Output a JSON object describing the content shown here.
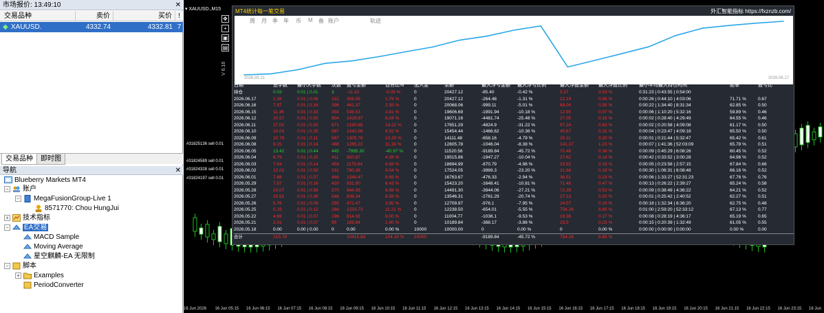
{
  "market_watch": {
    "title": "市场报价: 13:49:10",
    "columns": {
      "symbol": "交易品种",
      "bid": "卖价",
      "ask": "买价",
      "spread": "!"
    },
    "rows": [
      {
        "symbol": "XAUUSD.",
        "bid": "4332.74",
        "ask": "4332.81",
        "spread": "7"
      }
    ],
    "tabs": [
      "交易品种",
      "即时图"
    ]
  },
  "navigator": {
    "title": "导航",
    "root": "Blueberry Markets MT4",
    "accounts_label": "账户",
    "server": "MegaFusionGroup-Live 1",
    "account": "8571770: Chou HungJui",
    "indicators_label": "技术指标",
    "experts_label": "EA交易",
    "experts": [
      "MACD Sample",
      "Moving Average",
      "星空麒麟-EA 无限制"
    ],
    "scripts_label": "脚本",
    "scripts": [
      "Examples",
      "PeriodConverter"
    ]
  },
  "chart": {
    "title": "XAUUSD.,M15",
    "side_label": "V 6.16",
    "toolbar_icons": [
      "move-icon",
      "plus-icon",
      "floppy-icon",
      "screenshot-icon"
    ],
    "orders": [
      "#31825136 sell 0.01",
      "#31824589 sell 0.01",
      "#31824328 sell 0.01",
      "#31824197 sell 0.01"
    ],
    "time_axis": [
      "16 Jun 2026",
      "16 Jun 05:15",
      "16 Jun 06:15",
      "16 Jun 07:15",
      "16 Jun 08:15",
      "16 Jun 09:15",
      "16 Jun 10:15",
      "16 Jun 11:15",
      "16 Jun 12:15",
      "16 Jun 13:15",
      "16 Jun 14:15",
      "16 Jun 15:15",
      "16 Jun 16:15",
      "16 Jun 17:15",
      "16 Jun 18:15",
      "16 Jun 19:15",
      "16 Jun 20:15",
      "16 Jun 21:15",
      "16 Jun 22:15",
      "16 Jun 23:15",
      "16 Jun"
    ]
  },
  "panel": {
    "title": "MT4统计每一笔交易",
    "site": "外汇智能指标 https://fxznzb.com/",
    "period_tabs": [
      "日",
      "周",
      "月",
      "季",
      "年",
      "币",
      "M",
      "备",
      "账户",
      "轨迹"
    ],
    "selected_period": "日",
    "equity_start": "2026.05.21",
    "equity_end": "2026.06.17"
  },
  "table": {
    "headers": [
      "日期",
      "总手数",
      "最小大手数",
      "次数",
      "盈亏金额",
      "百分比%",
      "出入金",
      "余额",
      "最大浮亏金额",
      "最大浮亏比例",
      "最大浮盈金额",
      "最大浮盈比例",
      "最小平均最大持仓时间",
      "胜率",
      "盈亏比"
    ],
    "rows": [
      [
        "持仓",
        "0.03",
        "0.01 | 0.01",
        "3",
        "-11.23",
        "-0.05 %",
        "0",
        "20427.12",
        "-85.40",
        "-0.42 %",
        "5.57",
        "0.03 %",
        "0:31:23 | 0:43:55 | 0:54:00",
        "",
        ""
      ],
      [
        "2026.06.17",
        "2.26",
        "0.01 | 0.06",
        "152",
        "359.06",
        "1.79 %",
        "0",
        "20427.12",
        "-264.48",
        "-1.31 %",
        "12.19",
        "0.06 %",
        "0:00:26 | 0:44:10 | 4:03:06",
        "71.71 %",
        "0.67"
      ],
      [
        "2026.06.16",
        "7.87",
        "0.01 | 0.16",
        "296",
        "461.37",
        "2.35 %",
        "0",
        "20068.06",
        "-999.11",
        "-5.01 %",
        "68.04",
        "0.35 %",
        "0:00:22 | 1:34:40 | 8:31:34",
        "62.85 %",
        "0.50"
      ],
      [
        "2026.06.15",
        "11.36",
        "0.01 | 0.33",
        "354",
        "538.53",
        "2.81 %",
        "0",
        "19606.69",
        "-1991.94",
        "-10.18 %",
        "12.90",
        "0.07 %",
        "0:00:06 | 1:10:20 | 5:32:16",
        "59.89 %",
        "0.46"
      ],
      [
        "2026.06.12",
        "20.57",
        "0.01 | 0.50",
        "804",
        "1419.87",
        "8.04 %",
        "0",
        "19071.16",
        "-4481.74",
        "-25.48 %",
        "27.05",
        "0.15 %",
        "0:00:02 | 0:28:40 | 4:29:49",
        "64.55 %",
        "0.46"
      ],
      [
        "2026.06.11",
        "27.02",
        "0.01 | 0.50",
        "971",
        "2190.85",
        "14.22 %",
        "0",
        "17651.29",
        "-4824.9",
        "-31.22 %",
        "97.24",
        "0.63 %",
        "0:00:02 | 0:20:58 | 4:09:08",
        "61.17 %",
        "0.50"
      ],
      [
        "2026.06.10",
        "15.03",
        "0.01 | 0.25",
        "687",
        "1342.96",
        "9.52 %",
        "0",
        "15454.44",
        "-1466.62",
        "-10.36 %",
        "45.67",
        "0.32 %",
        "0:00:04 | 0:23:47 | 4:09:18",
        "65.50 %",
        "0.50"
      ],
      [
        "2026.06.09",
        "10.78",
        "0.01 | 0.11",
        "587",
        "1305.78",
        "10.20 %",
        "0",
        "14111.48",
        "-658.16",
        "-4.79 %",
        "20.11",
        "0.20 %",
        "0:00:01 | 0:21:44 | 5:32:47",
        "65.42 %",
        "0.61"
      ],
      [
        "2026.06.08",
        "9.15",
        "0.01 | 0.14",
        "468",
        "1285.22",
        "11.16 %",
        "0",
        "12805.78",
        "-1046.04",
        "-8.38 %",
        "141.37",
        "1.23 %",
        "0:00:07 | 1:41:36 | 52:03:09",
        "65.78 %",
        "0.51"
      ],
      [
        "2026.06.05",
        "13.42",
        "0.01 | 0.44",
        "445",
        "-7995.30",
        "-40.97 %",
        "0",
        "11520.56",
        "-9189.84",
        "-45.72 %",
        "70.46",
        "0.36 %",
        "0:00:09 | 0:45:29 | 6:08:26",
        "60.45 %",
        "0.52"
      ],
      [
        "2026.06.04",
        "6.79",
        "0.01 | 0.25",
        "411",
        "820.87",
        "4.39 %",
        "0",
        "19515.86",
        "-1947.27",
        "-10.04 %",
        "27.62",
        "0.14 %",
        "0:00:42 | 0:33:52 | 3:00:28",
        "64.96 %",
        "0.52"
      ],
      [
        "2026.06.03",
        "7.54",
        "0.01 | 0.14",
        "454",
        "1170.84",
        "6.68 %",
        "0",
        "18694.99",
        "-870.79",
        "-4.96 %",
        "33.92",
        "0.19 %",
        "0:00:05 | 0:23:58 | 2:57:15",
        "67.84 %",
        "0.66"
      ],
      [
        "2026.06.02",
        "12.01",
        "0.01 | 0.50",
        "331",
        "760.38",
        "4.54 %",
        "0",
        "17524.05",
        "-3969.3",
        "-23.20 %",
        "31.66",
        "0.19 %",
        "0:00:30 | 1:06:31 | 6:08:48",
        "66.16 %",
        "0.52"
      ],
      [
        "2026.06.01",
        "7.48",
        "0.01 | 0.07",
        "466",
        "1340.47",
        "8.69 %",
        "0",
        "16763.67",
        "-476.33",
        "-2.94 %",
        "36.51",
        "0.23 %",
        "0:00:06 | 1:33:27 | 52:31:23",
        "67.76 %",
        "0.76"
      ],
      [
        "2026.05.29",
        "7.57",
        "0.01 | 0.16",
        "420",
        "931.90",
        "6.43 %",
        "0",
        "15423.20",
        "-1648.41",
        "-10.81 %",
        "71.46",
        "0.47 %",
        "0:00:13 | 0:26:22 | 2:39:27",
        "65.24 %",
        "0.58"
      ],
      [
        "2026.05.28",
        "20.07",
        "0.01 | 0.58",
        "570",
        "944.99",
        "6.98 %",
        "0",
        "14491.30",
        "-3944.06",
        "-27.21 %",
        "72.39",
        "0.53 %",
        "0:00:09 | 0:38:49 | 4:36:22",
        "64.21 %",
        "0.52"
      ],
      [
        "2026.05.27",
        "15.61",
        "0.01 | 0.38",
        "546",
        "836.34",
        "6.58 %",
        "0",
        "13546.31",
        "-2761.29",
        "-20.74 %",
        "27.13",
        "0.20 %",
        "0:00:01 | 0:25:42 | 2:40:52",
        "62.27 %",
        "0.51"
      ],
      [
        "2026.05.26",
        "5.76",
        "0.01 | 0.09",
        "255",
        "471.47",
        "3.85 %",
        "0",
        "12709.97",
        "-976.1",
        "-7.95 %",
        "24.57",
        "0.19 %",
        "0:00:18 | 1:32:34 | 8:36:20",
        "62.75 %",
        "0.48"
      ],
      [
        "2026.05.25",
        "5.19",
        "0.01 | 0.12",
        "266",
        "1233.73",
        "11.21 %",
        "0",
        "12238.50",
        "-654.01",
        "-5.55 %",
        "754.26",
        "6.85 %",
        "0:01:00 | 2:59:20 | 52:33:12",
        "67.13 %",
        "0.77"
      ],
      [
        "2026.05.22",
        "4.69",
        "0.01 | 0.07",
        "196",
        "814.93",
        "8.00 %",
        "0",
        "11004.77",
        "-1036.1",
        "-9.53 %",
        "19.36",
        "0.17 %",
        "0:00:08 | 0:28:19 | 4:36:17",
        "65.19 %",
        "0.65"
      ],
      [
        "2026.05.21",
        "2.01",
        "0.01 | 0.07",
        "95",
        "189.84",
        "1.90 %",
        "0",
        "10189.84",
        "-388.17",
        "-3.86 %",
        "23.5",
        "0.23 %",
        "0:00:15 | 0:20:39 | 1:32:49",
        "61.05 %",
        "0.55"
      ],
      [
        "2026.05.18",
        "0.00",
        "0.00 | 0.00",
        "0",
        "0.00",
        "0.00 %",
        "10000",
        "10000.00",
        "0",
        "0.00 %",
        "0",
        "0.00 %",
        "0:00:00 | 0:00:00 | 0:00:00",
        "0.00 %",
        "0.00"
      ]
    ],
    "total": [
      "合计",
      "215.79",
      "",
      "",
      "10415.89",
      "104.16 %",
      "10000",
      "",
      "-9189.84",
      "-45.72 %",
      "754.26",
      "6.85 %",
      "",
      "",
      ""
    ]
  },
  "chart_data": {
    "type": "line",
    "title": "",
    "x": [
      "2026.05.18",
      "2026.05.21",
      "2026.05.22",
      "2026.05.25",
      "2026.05.26",
      "2026.05.27",
      "2026.05.28",
      "2026.05.29",
      "2026.06.01",
      "2026.06.02",
      "2026.06.03",
      "2026.06.04",
      "2026.06.05",
      "2026.06.08",
      "2026.06.09",
      "2026.06.10",
      "2026.06.11",
      "2026.06.12",
      "2026.06.15",
      "2026.06.16",
      "2026.06.17"
    ],
    "series": [
      {
        "values": [
          10000.0,
          10189.84,
          11004.77,
          12238.5,
          12709.97,
          13546.31,
          14491.3,
          15423.2,
          16763.67,
          17524.05,
          18694.99,
          19515.86,
          11520.56,
          12805.78,
          14111.48,
          15454.44,
          17651.29,
          19071.16,
          19606.69,
          20068.06,
          20427.12
        ]
      }
    ],
    "xlabel": "",
    "ylabel": "",
    "line_color": "#2aa6e8",
    "grid": false
  },
  "colors": {
    "selected_row": "#2f6fc7",
    "panel_bg": "#252a33",
    "title": "#ffd400",
    "negative": "#ff2a2a",
    "positive": "#27d52b"
  }
}
